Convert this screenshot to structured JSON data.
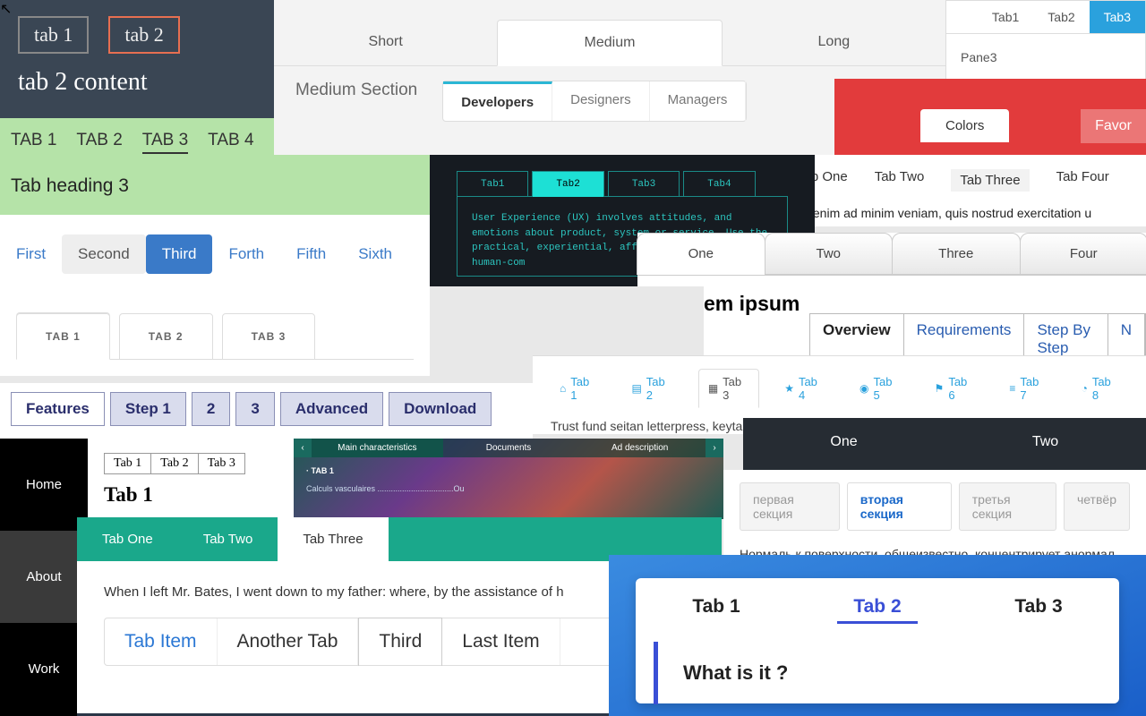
{
  "A": {
    "tabs": [
      "tab 1",
      "tab 2"
    ],
    "active": 1,
    "content": "tab 2 content"
  },
  "B": {
    "tabs": [
      "TAB 1",
      "TAB 2",
      "TAB 3",
      "TAB 4"
    ],
    "active": 2,
    "heading": "Tab heading 3"
  },
  "C": {
    "tabs": [
      "Short",
      "Medium",
      "Long"
    ],
    "active": 1,
    "section": "Medium Section",
    "sub": [
      "Developers",
      "Designers",
      "Managers"
    ],
    "sub_active": 0
  },
  "D": {
    "tabs": [
      "Tab1",
      "Tab2",
      "Tab3"
    ],
    "active": 2,
    "body": "Pane3"
  },
  "E": {
    "tab1": "Colors",
    "tab2": "Favor"
  },
  "F": {
    "tabs": [
      "Tab One",
      "Tab Two",
      "Tab Three",
      "Tab Four"
    ],
    "active": 2,
    "text": "Ut enim ad minim veniam, quis nostrud exercitation u"
  },
  "G": {
    "tabs": [
      "Tab1",
      "Tab2",
      "Tab3",
      "Tab4"
    ],
    "active": 1,
    "body": "User Experience (UX) involves attitudes, and emotions about product, system or service. Use the practical, experiential, affec valuable aspects of human-com"
  },
  "H": {
    "tabs": [
      "First",
      "Second",
      "Third",
      "Forth",
      "Fifth",
      "Sixth"
    ],
    "active": 2
  },
  "I": {
    "tabs": [
      "TAB 1",
      "TAB 2",
      "TAB 3"
    ],
    "active": 0
  },
  "J": {
    "tabs": [
      "Features",
      "Step 1",
      "2",
      "3",
      "Advanced",
      "Download"
    ],
    "active": 0
  },
  "K": {
    "items": [
      "Home",
      "About",
      "Work"
    ],
    "active": 1
  },
  "L": {
    "tabs": [
      "Tab 1",
      "Tab 2",
      "Tab 3"
    ],
    "heading": "Tab 1"
  },
  "M": {
    "tabs": [
      "Main characteristics",
      "Documents",
      "Ad description"
    ],
    "active": 0,
    "row1": "· TAB 1",
    "row2": "Calculs vasculaires ..................................Ou"
  },
  "N": {
    "tabs": [
      "One",
      "Two",
      "Three",
      "Four"
    ],
    "active": 0
  },
  "O": {
    "lead": "em ipsum",
    "tabs": [
      "Overview",
      "Requirements",
      "Step By Step",
      "N"
    ],
    "active": 0
  },
  "P": {
    "tabs": [
      {
        "icon": "⌂",
        "label": "Tab 1"
      },
      {
        "icon": "▤",
        "label": "Tab 2"
      },
      {
        "icon": "▦",
        "label": "Tab 3"
      },
      {
        "icon": "★",
        "label": "Tab 4"
      },
      {
        "icon": "◉",
        "label": "Tab 5"
      },
      {
        "icon": "⚑",
        "label": "Tab 6"
      },
      {
        "icon": "≡",
        "label": "Tab 7"
      },
      {
        "icon": "◔",
        "label": "Tab 8"
      }
    ],
    "active": 2,
    "body": "Trust fund seitan letterpress, keytar raw cosby sweater. Fanny pack portland se"
  },
  "Q": {
    "tabs": [
      "One",
      "Two"
    ]
  },
  "R": {
    "tabs": [
      "первая секция",
      "вторая секция",
      "третья секция",
      "четвёр"
    ],
    "active": 1,
    "body": "Нормаль к поверхности, общеизвестно, концентрирует анормал"
  },
  "S": {
    "tabs": [
      "Tab One",
      "Tab Two",
      "Tab Three"
    ],
    "active": 2,
    "text": "When I left Mr. Bates, I went down to my father: where, by the assistance of h",
    "inner": [
      "Tab Item",
      "Another Tab",
      "Third",
      "Last Item"
    ],
    "inner_sel": 2
  },
  "T": {
    "tabs": [
      "Tab 1",
      "Tab 2",
      "Tab 3"
    ],
    "active": 1,
    "body": "What is it ?"
  }
}
